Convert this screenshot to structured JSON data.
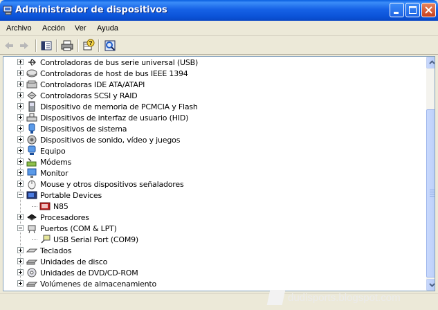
{
  "window": {
    "title": "Administrador de dispositivos"
  },
  "menu": [
    "Archivo",
    "Acción",
    "Ver",
    "Ayuda"
  ],
  "toolbar": {
    "buttons": [
      "back-arrow-icon",
      "forward-arrow-icon",
      "properties-icon",
      "print-icon",
      "help-icon",
      "scan-hardware-icon"
    ]
  },
  "tree": {
    "items": [
      {
        "label": "Controladoras de bus serie universal (USB)",
        "icon": "usb-icon",
        "level": 0,
        "expander": "plus"
      },
      {
        "label": "Controladoras de host de bus IEEE 1394",
        "icon": "ieee1394-icon",
        "level": 0,
        "expander": "plus"
      },
      {
        "label": "Controladoras IDE ATA/ATAPI",
        "icon": "ide-controller-icon",
        "level": 0,
        "expander": "plus"
      },
      {
        "label": "Controladoras SCSI y RAID",
        "icon": "scsi-icon",
        "level": 0,
        "expander": "plus"
      },
      {
        "label": "Dispositivo de memoria de PCMCIA y Flash",
        "icon": "pcmcia-icon",
        "level": 0,
        "expander": "plus"
      },
      {
        "label": "Dispositivos de interfaz de usuario (HID)",
        "icon": "hid-icon",
        "level": 0,
        "expander": "plus"
      },
      {
        "label": "Dispositivos de sistema",
        "icon": "system-devices-icon",
        "level": 0,
        "expander": "plus"
      },
      {
        "label": "Dispositivos de sonido, vídeo y juegos",
        "icon": "sound-icon",
        "level": 0,
        "expander": "plus"
      },
      {
        "label": "Equipo",
        "icon": "computer-icon",
        "level": 0,
        "expander": "plus"
      },
      {
        "label": "Módems",
        "icon": "modem-icon",
        "level": 0,
        "expander": "plus"
      },
      {
        "label": "Monitor",
        "icon": "monitor-icon",
        "level": 0,
        "expander": "plus"
      },
      {
        "label": "Mouse y otros dispositivos señaladores",
        "icon": "mouse-icon",
        "level": 0,
        "expander": "plus"
      },
      {
        "label": "Portable Devices",
        "icon": "portable-devices-icon",
        "level": 0,
        "expander": "minus"
      },
      {
        "label": "N85",
        "icon": "phone-icon",
        "level": 1,
        "expander": "none"
      },
      {
        "label": "Procesadores",
        "icon": "processor-icon",
        "level": 0,
        "expander": "plus"
      },
      {
        "label": "Puertos (COM & LPT)",
        "icon": "port-icon",
        "level": 0,
        "expander": "minus"
      },
      {
        "label": "USB Serial Port (COM9)",
        "icon": "serial-port-icon",
        "level": 1,
        "expander": "none"
      },
      {
        "label": "Teclados",
        "icon": "keyboard-icon",
        "level": 0,
        "expander": "plus"
      },
      {
        "label": "Unidades de disco",
        "icon": "disk-drive-icon",
        "level": 0,
        "expander": "plus"
      },
      {
        "label": "Unidades de DVD/CD-ROM",
        "icon": "dvd-drive-icon",
        "level": 0,
        "expander": "plus"
      },
      {
        "label": "Volúmenes de almacenamiento",
        "icon": "storage-volume-icon",
        "level": 0,
        "expander": "plus"
      }
    ]
  },
  "watermark": {
    "text": "dudisports.blogspot.com"
  },
  "colors": {
    "titlebar": "#0B53D8",
    "tree_bg": "#FFFFFF",
    "chrome": "#ECE9D8"
  }
}
